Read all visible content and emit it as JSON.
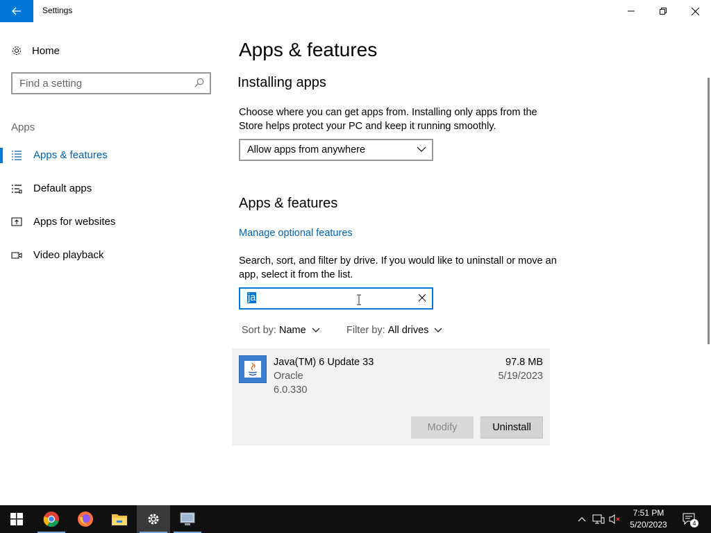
{
  "window": {
    "title": "Settings",
    "accent": "#0078d7"
  },
  "sidebar": {
    "home_label": "Home",
    "search_placeholder": "Find a setting",
    "section": "Apps",
    "items": [
      {
        "label": "Apps & features",
        "icon": "list-icon",
        "active": true
      },
      {
        "label": "Default apps",
        "icon": "default-apps-icon",
        "active": false
      },
      {
        "label": "Apps for websites",
        "icon": "websites-icon",
        "active": false
      },
      {
        "label": "Video playback",
        "icon": "video-icon",
        "active": false
      }
    ]
  },
  "main": {
    "title": "Apps & features",
    "installing": {
      "heading": "Installing apps",
      "description": "Choose where you can get apps from. Installing only apps from the Store helps protect your PC and keep it running smoothly.",
      "dropdown_value": "Allow apps from anywhere"
    },
    "features": {
      "heading": "Apps & features",
      "manage_link": "Manage optional features",
      "description": "Search, sort, and filter by drive. If you would like to uninstall or move an app, select it from the list.",
      "search_value": "ja",
      "sort_label": "Sort by:",
      "sort_value": "Name",
      "filter_label": "Filter by:",
      "filter_value": "All drives"
    },
    "apps": [
      {
        "name": "Java(TM) 6 Update 33",
        "publisher": "Oracle",
        "version": "6.0.330",
        "size": "97.8 MB",
        "date": "5/19/2023",
        "modify_label": "Modify",
        "uninstall_label": "Uninstall"
      }
    ]
  },
  "taskbar": {
    "apps": [
      "start-icon",
      "chrome-icon",
      "firefox-icon",
      "file-explorer-icon",
      "settings-icon",
      "remote-desktop-icon"
    ],
    "time": "7:51 PM",
    "date": "5/20/2023",
    "notification_count": "4"
  }
}
